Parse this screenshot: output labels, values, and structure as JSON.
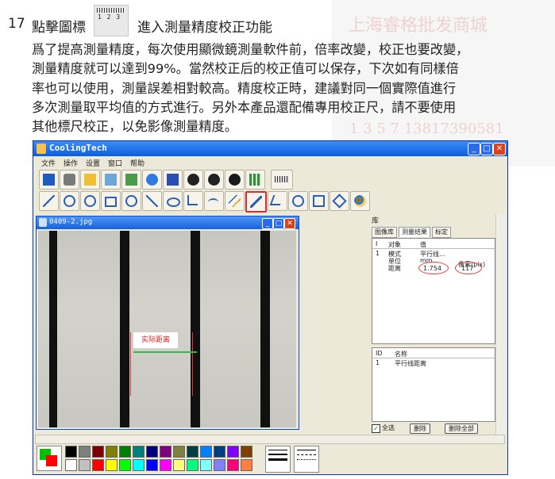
{
  "watermark": {
    "line1": "上海睿格批发商城",
    "line2": "1 3 5 7  13817390581"
  },
  "step": {
    "number": "17",
    "title_prefix": "點擊圖標",
    "title_suffix": "，進入測量精度校正功能",
    "icon_numbers": "1 2 3"
  },
  "paragraph": [
    "爲了提高測量精度，每次使用顯微鏡測量軟件前，倍率改變，校正也要改變，",
    "測量精度就可以達到99%。當然校正后的校正值可以保存，下次如有同樣倍",
    "率也可以使用，測量誤差相對較高。精度校正時，建議對同一個實際值進行",
    "多次測量取平均值的方式進行。另外本產品還配備專用校正尺，請不要使用",
    "其他標尺校正，以免影像測量精度。"
  ],
  "app": {
    "title": "CoolingTech",
    "menu": [
      "文件",
      "操作",
      "设置",
      "窗口",
      "帮助"
    ],
    "toolbar1_icons": [
      "display-icon",
      "camera-icon",
      "open-icon",
      "image-list-icon",
      "image-icon",
      "refresh-icon",
      "save-icon",
      "pause-icon",
      "stop-icon",
      "wrench-icon",
      "grid-icon",
      "ruler-icon"
    ],
    "toolbar2_icons": [
      "line-icon",
      "zoom-icon",
      "circle-arrow-icon",
      "rectangle-icon",
      "circle-icon",
      "polyline-icon",
      "ellipse-icon",
      "angle-icon",
      "arc-icon",
      "parallel-icon",
      "calibrate-icon",
      "angle-measure-icon",
      "symbol-a-icon",
      "symbol-b-icon",
      "symbol-c-icon",
      "palette-icon"
    ],
    "selected_tool": "calibrate-icon"
  },
  "child_window": {
    "title": "0409-2.jpg",
    "label": "实际距离"
  },
  "panel": {
    "title": "库",
    "tabs": [
      "图像库",
      "测量结果",
      "标定"
    ],
    "active_tab": "测量结果",
    "cols": [
      "I",
      "对象",
      "值"
    ],
    "rows": [
      {
        "id": "1",
        "obj": "模式",
        "val": "平行线..."
      },
      {
        "id": "",
        "obj": "单位",
        "val": "mm",
        "extra": "像素(pix)"
      },
      {
        "id": "",
        "obj": "距离",
        "val": "1.754",
        "extra": "117"
      }
    ],
    "list2_cols": [
      "ID",
      "名称"
    ],
    "list2_rows": [
      {
        "id": "1",
        "name": "平行线距离"
      }
    ],
    "select_all": "全选",
    "delete": "删除",
    "delete_all": "删除全部"
  },
  "colors": {
    "palette": [
      "#000000",
      "#7f7f7f",
      "#7f0000",
      "#7f7f00",
      "#007f00",
      "#007f7f",
      "#00007f",
      "#7f007f",
      "#7f7f3f",
      "#003f3f",
      "#007fff",
      "#003f7f",
      "#7f00ff",
      "#7f3f00",
      "#ffffff",
      "#c0c0c0",
      "#ff0000",
      "#ffff00",
      "#00ff00",
      "#00ffff",
      "#0000ff",
      "#ff00ff",
      "#ffff7f",
      "#00ff7f",
      "#7fffff",
      "#7f7fff",
      "#ff007f",
      "#ff7f3f"
    ],
    "fg": "#00c000",
    "bg": "#ff0000"
  }
}
